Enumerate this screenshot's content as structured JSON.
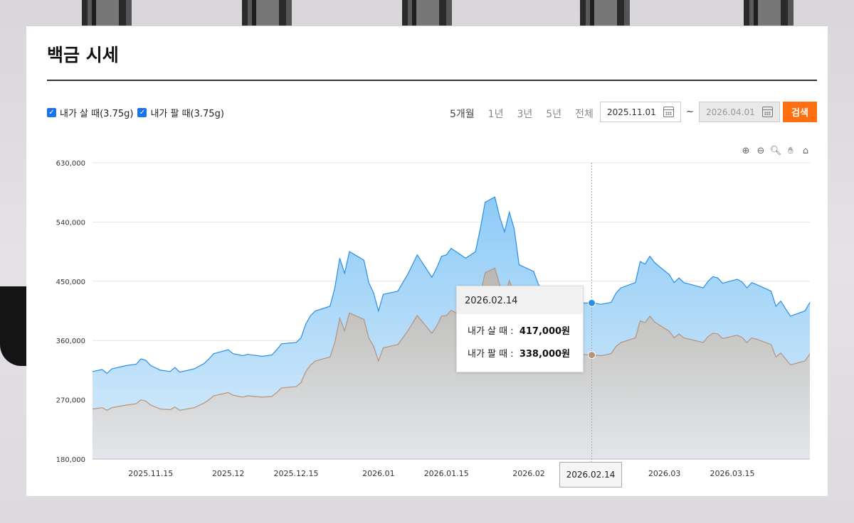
{
  "header": {
    "title": "백금 시세"
  },
  "legend": [
    {
      "label": "내가 살 때(3.75g)",
      "checked": true
    },
    {
      "label": "내가 팔 때(3.75g)",
      "checked": true
    }
  ],
  "periods": [
    "5개월",
    "1년",
    "3년",
    "5년",
    "전체"
  ],
  "date_range": {
    "start": "2025.11.01",
    "end": "2026.04.01",
    "separator": "~"
  },
  "search_label": "검색",
  "tooltip": {
    "date": "2026.02.14",
    "rows": [
      {
        "label": "내가 살 때 :",
        "value": "417,000원"
      },
      {
        "label": "내가 팔 때 :",
        "value": "338,000원"
      }
    ]
  },
  "crosshair_label": "2026.02.14",
  "colors": {
    "buy": "#2a8ee8",
    "buy_fill": "#8ecbf7",
    "sell": "#b7927a",
    "sell_fill": "#c9cdd2",
    "accent": "#ff6f0f"
  },
  "chart_data": {
    "type": "area",
    "y_ticks": [
      "630,000",
      "540,000",
      "450,000",
      "360,000",
      "270,000",
      "180,000"
    ],
    "ylim": [
      180000,
      630000
    ],
    "x_ticks": [
      {
        "date": "2025.11.15",
        "label": "2025.11.15"
      },
      {
        "date": "2025.12.01",
        "label": "2025.12"
      },
      {
        "date": "2025.12.15",
        "label": "2025.12.15"
      },
      {
        "date": "2026.01.01",
        "label": "2026.01"
      },
      {
        "date": "2026.01.15",
        "label": "2026.01.15"
      },
      {
        "date": "2026.02.01",
        "label": "2026.02"
      },
      {
        "date": "2026.03.01",
        "label": "2026.03"
      },
      {
        "date": "2026.03.15",
        "label": "2026.03.15"
      }
    ],
    "xlim": [
      "2025.11.03",
      "2026.03.31"
    ],
    "series": [
      {
        "name": "내가 살 때(3.75g)",
        "points": [
          [
            "2025.11.03",
            313000
          ],
          [
            "2025.11.05",
            316000
          ],
          [
            "2025.11.06",
            310000
          ],
          [
            "2025.11.07",
            317000
          ],
          [
            "2025.11.10",
            322000
          ],
          [
            "2025.11.12",
            324000
          ],
          [
            "2025.11.13",
            332000
          ],
          [
            "2025.11.14",
            330000
          ],
          [
            "2025.11.15",
            322000
          ],
          [
            "2025.11.17",
            315000
          ],
          [
            "2025.11.19",
            313000
          ],
          [
            "2025.11.20",
            319000
          ],
          [
            "2025.11.21",
            312000
          ],
          [
            "2025.11.24",
            317000
          ],
          [
            "2025.11.26",
            325000
          ],
          [
            "2025.11.27",
            332000
          ],
          [
            "2025.11.28",
            340000
          ],
          [
            "2025.12.01",
            346000
          ],
          [
            "2025.12.02",
            340000
          ],
          [
            "2025.12.04",
            337000
          ],
          [
            "2025.12.05",
            339000
          ],
          [
            "2025.12.08",
            336000
          ],
          [
            "2025.12.10",
            338000
          ],
          [
            "2025.12.11",
            346000
          ],
          [
            "2025.12.12",
            355000
          ],
          [
            "2025.12.15",
            357000
          ],
          [
            "2025.12.16",
            364000
          ],
          [
            "2025.12.17",
            385000
          ],
          [
            "2025.12.18",
            398000
          ],
          [
            "2025.12.19",
            405000
          ],
          [
            "2025.12.22",
            412000
          ],
          [
            "2025.12.23",
            440000
          ],
          [
            "2025.12.24",
            485000
          ],
          [
            "2025.12.25",
            462000
          ],
          [
            "2025.12.26",
            495000
          ],
          [
            "2025.12.29",
            482000
          ],
          [
            "2025.12.30",
            448000
          ],
          [
            "2025.12.31",
            432000
          ],
          [
            "2026.01.01",
            405000
          ],
          [
            "2026.01.02",
            430000
          ],
          [
            "2026.01.05",
            435000
          ],
          [
            "2026.01.06",
            448000
          ],
          [
            "2026.01.07",
            460000
          ],
          [
            "2026.01.08",
            475000
          ],
          [
            "2026.01.09",
            490000
          ],
          [
            "2026.01.12",
            456000
          ],
          [
            "2026.01.13",
            470000
          ],
          [
            "2026.01.14",
            488000
          ],
          [
            "2026.01.15",
            490000
          ],
          [
            "2026.01.16",
            500000
          ],
          [
            "2026.01.19",
            485000
          ],
          [
            "2026.01.20",
            490000
          ],
          [
            "2026.01.21",
            495000
          ],
          [
            "2026.01.22",
            530000
          ],
          [
            "2026.01.23",
            570000
          ],
          [
            "2026.01.25",
            578000
          ],
          [
            "2026.01.26",
            548000
          ],
          [
            "2026.01.27",
            525000
          ],
          [
            "2026.01.28",
            555000
          ],
          [
            "2026.01.29",
            530000
          ],
          [
            "2026.01.30",
            475000
          ],
          [
            "2026.02.02",
            465000
          ],
          [
            "2026.02.03",
            445000
          ],
          [
            "2026.02.05",
            428000
          ],
          [
            "2026.02.09",
            422000
          ],
          [
            "2026.02.12",
            417000
          ],
          [
            "2026.02.14",
            417000
          ],
          [
            "2026.02.16",
            415000
          ],
          [
            "2026.02.18",
            418000
          ],
          [
            "2026.02.19",
            432000
          ],
          [
            "2026.02.20",
            440000
          ],
          [
            "2026.02.23",
            448000
          ],
          [
            "2026.02.24",
            480000
          ],
          [
            "2026.02.25",
            476000
          ],
          [
            "2026.02.26",
            488000
          ],
          [
            "2026.02.27",
            478000
          ],
          [
            "2026.03.02",
            460000
          ],
          [
            "2026.03.03",
            448000
          ],
          [
            "2026.03.04",
            455000
          ],
          [
            "2026.03.05",
            448000
          ],
          [
            "2026.03.09",
            440000
          ],
          [
            "2026.03.10",
            450000
          ],
          [
            "2026.03.11",
            457000
          ],
          [
            "2026.03.12",
            455000
          ],
          [
            "2026.03.13",
            447000
          ],
          [
            "2026.03.16",
            453000
          ],
          [
            "2026.03.17",
            449000
          ],
          [
            "2026.03.18",
            440000
          ],
          [
            "2026.03.19",
            448000
          ],
          [
            "2026.03.20",
            445000
          ],
          [
            "2026.03.23",
            435000
          ],
          [
            "2026.03.24",
            412000
          ],
          [
            "2026.03.25",
            420000
          ],
          [
            "2026.03.26",
            408000
          ],
          [
            "2026.03.27",
            397000
          ],
          [
            "2026.03.30",
            405000
          ],
          [
            "2026.03.31",
            418000
          ]
        ]
      },
      {
        "name": "내가 팔 때(3.75g)",
        "points": [
          [
            "2025.11.03",
            256000
          ],
          [
            "2025.11.05",
            258000
          ],
          [
            "2025.11.06",
            254000
          ],
          [
            "2025.11.07",
            258000
          ],
          [
            "2025.11.10",
            262000
          ],
          [
            "2025.11.12",
            264000
          ],
          [
            "2025.11.13",
            270000
          ],
          [
            "2025.11.14",
            268000
          ],
          [
            "2025.11.15",
            262000
          ],
          [
            "2025.11.17",
            256000
          ],
          [
            "2025.11.19",
            255000
          ],
          [
            "2025.11.20",
            259000
          ],
          [
            "2025.11.21",
            254000
          ],
          [
            "2025.11.24",
            258000
          ],
          [
            "2025.11.26",
            265000
          ],
          [
            "2025.11.27",
            270000
          ],
          [
            "2025.11.28",
            276000
          ],
          [
            "2025.12.01",
            281000
          ],
          [
            "2025.12.02",
            277000
          ],
          [
            "2025.12.04",
            274000
          ],
          [
            "2025.12.05",
            276000
          ],
          [
            "2025.12.08",
            274000
          ],
          [
            "2025.12.10",
            275000
          ],
          [
            "2025.12.11",
            281000
          ],
          [
            "2025.12.12",
            288000
          ],
          [
            "2025.12.15",
            290000
          ],
          [
            "2025.12.16",
            296000
          ],
          [
            "2025.12.17",
            313000
          ],
          [
            "2025.12.18",
            323000
          ],
          [
            "2025.12.19",
            329000
          ],
          [
            "2025.12.22",
            335000
          ],
          [
            "2025.12.23",
            357000
          ],
          [
            "2025.12.24",
            394000
          ],
          [
            "2025.12.25",
            375000
          ],
          [
            "2025.12.26",
            402000
          ],
          [
            "2025.12.29",
            392000
          ],
          [
            "2025.12.30",
            364000
          ],
          [
            "2025.12.31",
            351000
          ],
          [
            "2026.01.01",
            329000
          ],
          [
            "2026.01.02",
            349000
          ],
          [
            "2026.01.05",
            354000
          ],
          [
            "2026.01.06",
            364000
          ],
          [
            "2026.01.07",
            374000
          ],
          [
            "2026.01.08",
            386000
          ],
          [
            "2026.01.09",
            398000
          ],
          [
            "2026.01.12",
            371000
          ],
          [
            "2026.01.13",
            382000
          ],
          [
            "2026.01.14",
            397000
          ],
          [
            "2026.01.15",
            398000
          ],
          [
            "2026.01.16",
            406000
          ],
          [
            "2026.01.19",
            394000
          ],
          [
            "2026.01.20",
            398000
          ],
          [
            "2026.01.21",
            402000
          ],
          [
            "2026.01.22",
            430000
          ],
          [
            "2026.01.23",
            463000
          ],
          [
            "2026.01.25",
            470000
          ],
          [
            "2026.01.26",
            445000
          ],
          [
            "2026.01.27",
            427000
          ],
          [
            "2026.01.28",
            451000
          ],
          [
            "2026.01.29",
            431000
          ],
          [
            "2026.01.30",
            386000
          ],
          [
            "2026.02.02",
            378000
          ],
          [
            "2026.02.03",
            362000
          ],
          [
            "2026.02.05",
            348000
          ],
          [
            "2026.02.09",
            343000
          ],
          [
            "2026.02.12",
            339000
          ],
          [
            "2026.02.14",
            338000
          ],
          [
            "2026.02.16",
            337000
          ],
          [
            "2026.02.18",
            340000
          ],
          [
            "2026.02.19",
            351000
          ],
          [
            "2026.02.20",
            357000
          ],
          [
            "2026.02.23",
            364000
          ],
          [
            "2026.02.24",
            390000
          ],
          [
            "2026.02.25",
            387000
          ],
          [
            "2026.02.26",
            397000
          ],
          [
            "2026.02.27",
            388000
          ],
          [
            "2026.03.02",
            374000
          ],
          [
            "2026.03.03",
            364000
          ],
          [
            "2026.03.04",
            370000
          ],
          [
            "2026.03.05",
            364000
          ],
          [
            "2026.03.09",
            357000
          ],
          [
            "2026.03.10",
            366000
          ],
          [
            "2026.03.11",
            371000
          ],
          [
            "2026.03.12",
            370000
          ],
          [
            "2026.03.13",
            363000
          ],
          [
            "2026.03.16",
            368000
          ],
          [
            "2026.03.17",
            365000
          ],
          [
            "2026.03.18",
            357000
          ],
          [
            "2026.03.19",
            364000
          ],
          [
            "2026.03.20",
            362000
          ],
          [
            "2026.03.23",
            354000
          ],
          [
            "2026.03.24",
            335000
          ],
          [
            "2026.03.25",
            341000
          ],
          [
            "2026.03.26",
            332000
          ],
          [
            "2026.03.27",
            323000
          ],
          [
            "2026.03.30",
            329000
          ],
          [
            "2026.03.31",
            340000
          ]
        ]
      }
    ],
    "crosshair_date": "2026.02.14"
  }
}
